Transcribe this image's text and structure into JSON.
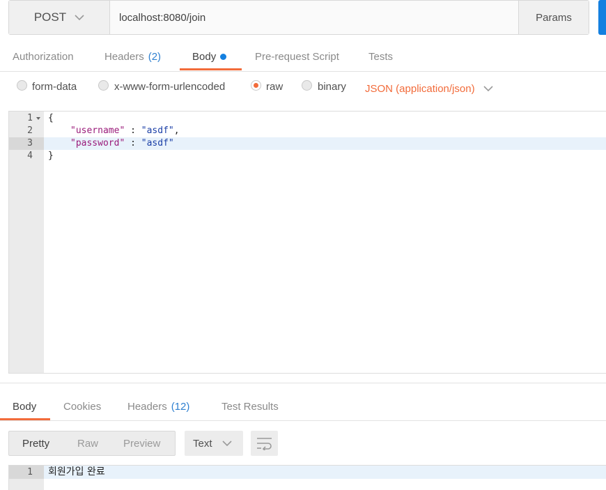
{
  "request": {
    "method": "POST",
    "url": "localhost:8080/join",
    "params_label": "Params"
  },
  "req_tabs": [
    {
      "label": "Authorization",
      "count": ""
    },
    {
      "label": "Headers",
      "count": "(2)"
    },
    {
      "label": "Body",
      "count": ""
    },
    {
      "label": "Pre-request Script",
      "count": ""
    },
    {
      "label": "Tests",
      "count": ""
    }
  ],
  "body_modes": {
    "form_data": "form-data",
    "urlencoded": "x-www-form-urlencoded",
    "raw": "raw",
    "binary": "binary",
    "selected": "raw",
    "content_type": "JSON (application/json)"
  },
  "editor": {
    "lines": [
      {
        "num": "1",
        "text": "{"
      },
      {
        "num": "2",
        "key": "\"username\"",
        "sep": " : ",
        "value": "\"asdf\"",
        "tail": ","
      },
      {
        "num": "3",
        "key": "\"password\"",
        "sep": " : ",
        "value": "\"asdf\"",
        "tail": ""
      },
      {
        "num": "4",
        "text": "}"
      }
    ]
  },
  "res_tabs": [
    {
      "label": "Body",
      "count": ""
    },
    {
      "label": "Cookies",
      "count": ""
    },
    {
      "label": "Headers",
      "count": "(12)"
    },
    {
      "label": "Test Results",
      "count": ""
    }
  ],
  "response": {
    "views": [
      "Pretty",
      "Raw",
      "Preview"
    ],
    "selected_view": "Pretty",
    "format": "Text",
    "line_num": "1",
    "text": "회원가입 완료"
  },
  "colors": {
    "accent": "#f26b3a",
    "send": "#1480e0"
  }
}
